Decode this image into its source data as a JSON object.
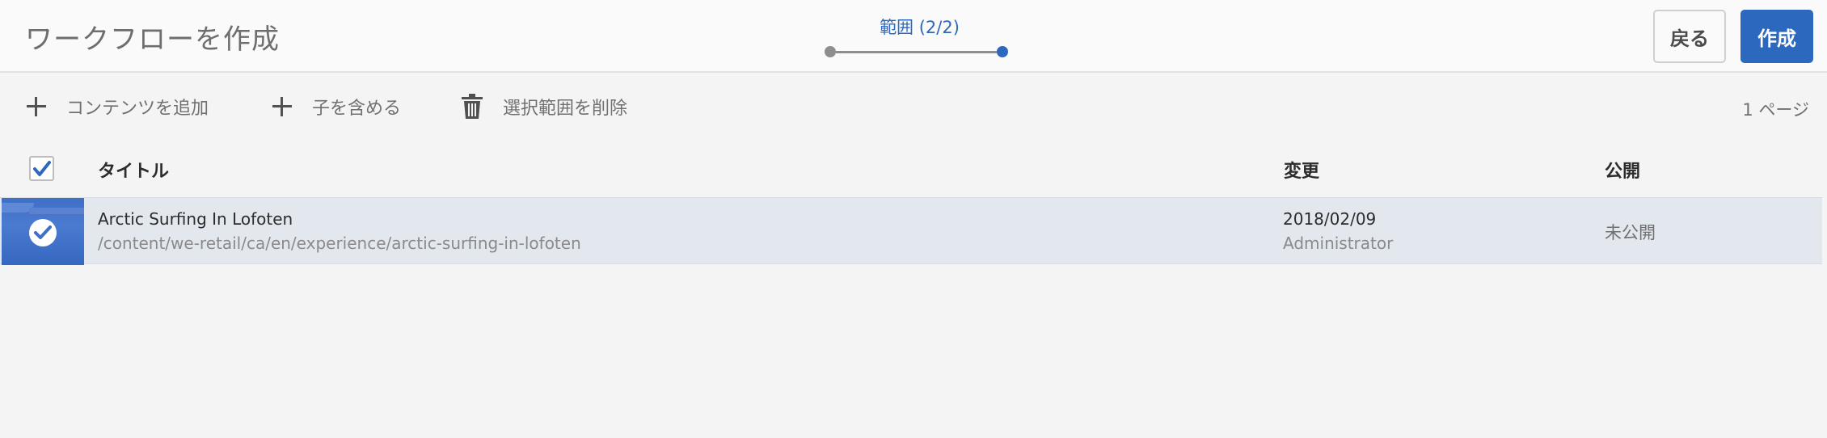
{
  "header": {
    "title": "ワークフローを作成",
    "step_label": "範囲 (2/2)",
    "back_label": "戻る",
    "create_label": "作成"
  },
  "toolbar": {
    "add_content_label": "コンテンツを追加",
    "include_children_label": "子を含める",
    "delete_selection_label": "選択範囲を削除",
    "page_count": "1 ページ"
  },
  "table": {
    "columns": [
      "タイトル",
      "変更",
      "公開"
    ],
    "header_checkbox_checked": true,
    "rows": [
      {
        "title": "Arctic Surfing In Lofoten",
        "path": "/content/we-retail/ca/en/experience/arctic-surfing-in-lofoten",
        "modified_date": "2018/02/09",
        "modified_by": "Administrator",
        "published": "未公開",
        "selected": true
      }
    ]
  },
  "colors": {
    "accent": "#2d68bf",
    "selected_row": "#e3e8ef",
    "background": "#f4f4f4"
  },
  "icons": [
    "plus-icon",
    "trash-icon",
    "checkmark-icon"
  ]
}
